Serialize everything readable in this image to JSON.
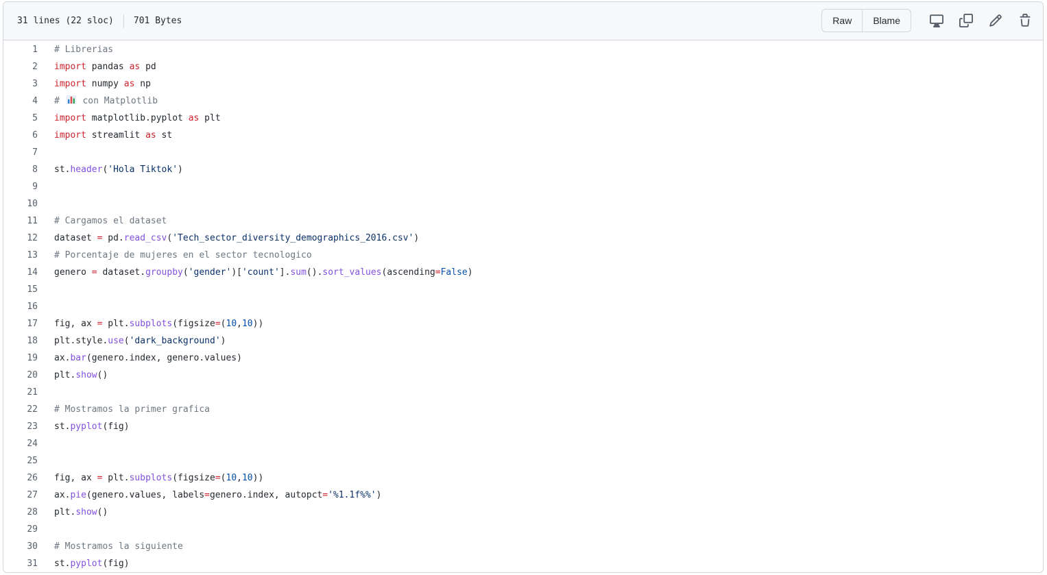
{
  "file_header": {
    "lines_info": "31 lines (22 sloc)",
    "size_info": "701 Bytes",
    "raw_label": "Raw",
    "blame_label": "Blame"
  },
  "colors": {
    "comment": "#6e7781",
    "keyword": "#cf222e",
    "function": "#8250df",
    "string": "#0a3069",
    "constant": "#0550ae",
    "text": "#24292f"
  },
  "icons": [
    "display-icon",
    "copy-icon",
    "pencil-icon",
    "trash-icon"
  ],
  "code_lines": [
    {
      "n": "1",
      "tokens": [
        {
          "t": "# Librerias",
          "k": "comment"
        }
      ]
    },
    {
      "n": "2",
      "tokens": [
        {
          "t": "import",
          "k": "keyword"
        },
        {
          "t": " pandas ",
          "k": "text"
        },
        {
          "t": "as",
          "k": "keyword"
        },
        {
          "t": " pd",
          "k": "text"
        }
      ]
    },
    {
      "n": "3",
      "tokens": [
        {
          "t": "import",
          "k": "keyword"
        },
        {
          "t": " numpy ",
          "k": "text"
        },
        {
          "t": "as",
          "k": "keyword"
        },
        {
          "t": " np",
          "k": "text"
        }
      ]
    },
    {
      "n": "4",
      "tokens": [
        {
          "t": "# ",
          "k": "comment"
        },
        {
          "t": "bar-chart-emoji",
          "k": "emoji"
        },
        {
          "t": " con Matplotlib",
          "k": "comment"
        }
      ]
    },
    {
      "n": "5",
      "tokens": [
        {
          "t": "import",
          "k": "keyword"
        },
        {
          "t": " matplotlib.pyplot ",
          "k": "text"
        },
        {
          "t": "as",
          "k": "keyword"
        },
        {
          "t": " plt",
          "k": "text"
        }
      ]
    },
    {
      "n": "6",
      "tokens": [
        {
          "t": "import",
          "k": "keyword"
        },
        {
          "t": " streamlit ",
          "k": "text"
        },
        {
          "t": "as",
          "k": "keyword"
        },
        {
          "t": " st",
          "k": "text"
        }
      ]
    },
    {
      "n": "7",
      "tokens": []
    },
    {
      "n": "8",
      "tokens": [
        {
          "t": "st.",
          "k": "text"
        },
        {
          "t": "header",
          "k": "function"
        },
        {
          "t": "(",
          "k": "text"
        },
        {
          "t": "'Hola Tiktok'",
          "k": "string"
        },
        {
          "t": ")",
          "k": "text"
        }
      ]
    },
    {
      "n": "9",
      "tokens": []
    },
    {
      "n": "10",
      "tokens": []
    },
    {
      "n": "11",
      "tokens": [
        {
          "t": "# Cargamos el dataset",
          "k": "comment"
        }
      ]
    },
    {
      "n": "12",
      "tokens": [
        {
          "t": "dataset ",
          "k": "text"
        },
        {
          "t": "=",
          "k": "keyword"
        },
        {
          "t": " pd.",
          "k": "text"
        },
        {
          "t": "read_csv",
          "k": "function"
        },
        {
          "t": "(",
          "k": "text"
        },
        {
          "t": "'Tech_sector_diversity_demographics_2016.csv'",
          "k": "string"
        },
        {
          "t": ")",
          "k": "text"
        }
      ]
    },
    {
      "n": "13",
      "tokens": [
        {
          "t": "# Porcentaje de mujeres en el sector tecnologico",
          "k": "comment"
        }
      ]
    },
    {
      "n": "14",
      "tokens": [
        {
          "t": "genero ",
          "k": "text"
        },
        {
          "t": "=",
          "k": "keyword"
        },
        {
          "t": " dataset.",
          "k": "text"
        },
        {
          "t": "groupby",
          "k": "function"
        },
        {
          "t": "(",
          "k": "text"
        },
        {
          "t": "'gender'",
          "k": "string"
        },
        {
          "t": ")[",
          "k": "text"
        },
        {
          "t": "'count'",
          "k": "string"
        },
        {
          "t": "].",
          "k": "text"
        },
        {
          "t": "sum",
          "k": "function"
        },
        {
          "t": "().",
          "k": "text"
        },
        {
          "t": "sort_values",
          "k": "function"
        },
        {
          "t": "(ascending",
          "k": "text"
        },
        {
          "t": "=",
          "k": "keyword"
        },
        {
          "t": "False",
          "k": "constant"
        },
        {
          "t": ")",
          "k": "text"
        }
      ]
    },
    {
      "n": "15",
      "tokens": []
    },
    {
      "n": "16",
      "tokens": []
    },
    {
      "n": "17",
      "tokens": [
        {
          "t": "fig, ax ",
          "k": "text"
        },
        {
          "t": "=",
          "k": "keyword"
        },
        {
          "t": " plt.",
          "k": "text"
        },
        {
          "t": "subplots",
          "k": "function"
        },
        {
          "t": "(figsize",
          "k": "text"
        },
        {
          "t": "=",
          "k": "keyword"
        },
        {
          "t": "(",
          "k": "text"
        },
        {
          "t": "10",
          "k": "constant"
        },
        {
          "t": ",",
          "k": "text"
        },
        {
          "t": "10",
          "k": "constant"
        },
        {
          "t": "))",
          "k": "text"
        }
      ]
    },
    {
      "n": "18",
      "tokens": [
        {
          "t": "plt.style.",
          "k": "text"
        },
        {
          "t": "use",
          "k": "function"
        },
        {
          "t": "(",
          "k": "text"
        },
        {
          "t": "'dark_background'",
          "k": "string"
        },
        {
          "t": ")",
          "k": "text"
        }
      ]
    },
    {
      "n": "19",
      "tokens": [
        {
          "t": "ax.",
          "k": "text"
        },
        {
          "t": "bar",
          "k": "function"
        },
        {
          "t": "(genero.index, genero.values)",
          "k": "text"
        }
      ]
    },
    {
      "n": "20",
      "tokens": [
        {
          "t": "plt.",
          "k": "text"
        },
        {
          "t": "show",
          "k": "function"
        },
        {
          "t": "()",
          "k": "text"
        }
      ]
    },
    {
      "n": "21",
      "tokens": []
    },
    {
      "n": "22",
      "tokens": [
        {
          "t": "# Mostramos la primer grafica",
          "k": "comment"
        }
      ]
    },
    {
      "n": "23",
      "tokens": [
        {
          "t": "st.",
          "k": "text"
        },
        {
          "t": "pyplot",
          "k": "function"
        },
        {
          "t": "(fig)",
          "k": "text"
        }
      ]
    },
    {
      "n": "24",
      "tokens": []
    },
    {
      "n": "25",
      "tokens": []
    },
    {
      "n": "26",
      "tokens": [
        {
          "t": "fig, ax ",
          "k": "text"
        },
        {
          "t": "=",
          "k": "keyword"
        },
        {
          "t": " plt.",
          "k": "text"
        },
        {
          "t": "subplots",
          "k": "function"
        },
        {
          "t": "(figsize",
          "k": "text"
        },
        {
          "t": "=",
          "k": "keyword"
        },
        {
          "t": "(",
          "k": "text"
        },
        {
          "t": "10",
          "k": "constant"
        },
        {
          "t": ",",
          "k": "text"
        },
        {
          "t": "10",
          "k": "constant"
        },
        {
          "t": "))",
          "k": "text"
        }
      ]
    },
    {
      "n": "27",
      "tokens": [
        {
          "t": "ax.",
          "k": "text"
        },
        {
          "t": "pie",
          "k": "function"
        },
        {
          "t": "(genero.values, labels",
          "k": "text"
        },
        {
          "t": "=",
          "k": "keyword"
        },
        {
          "t": "genero.index, autopct",
          "k": "text"
        },
        {
          "t": "=",
          "k": "keyword"
        },
        {
          "t": "'%1.1f%%'",
          "k": "string"
        },
        {
          "t": ")",
          "k": "text"
        }
      ]
    },
    {
      "n": "28",
      "tokens": [
        {
          "t": "plt.",
          "k": "text"
        },
        {
          "t": "show",
          "k": "function"
        },
        {
          "t": "()",
          "k": "text"
        }
      ]
    },
    {
      "n": "29",
      "tokens": []
    },
    {
      "n": "30",
      "tokens": [
        {
          "t": "# Mostramos la siguiente",
          "k": "comment"
        }
      ]
    },
    {
      "n": "31",
      "tokens": [
        {
          "t": "st.",
          "k": "text"
        },
        {
          "t": "pyplot",
          "k": "function"
        },
        {
          "t": "(fig)",
          "k": "text"
        }
      ]
    }
  ]
}
